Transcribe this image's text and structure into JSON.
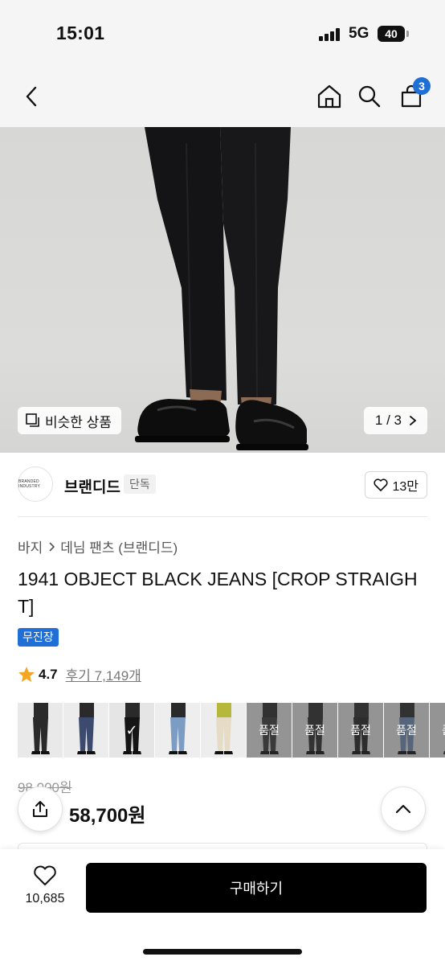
{
  "status_bar": {
    "time": "15:01",
    "network": "5G",
    "battery": "40"
  },
  "header": {
    "cart_count": "3"
  },
  "hero": {
    "similar_label": "비슷한 상품",
    "page_indicator": "1 / 3"
  },
  "brand": {
    "logo_text": "BRANDED INDUSTRY",
    "name": "브랜디드",
    "tag": "단독",
    "likes": "13만"
  },
  "breadcrumb": {
    "level1": "바지",
    "level2": "데님 팬츠 (브랜디드)"
  },
  "product": {
    "title": "1941 OBJECT BLACK JEANS [CROP STRAIGHT]",
    "badge": "무진장",
    "rating": "4.7",
    "review_label": "후기 7,149개"
  },
  "color_options": [
    {
      "jeans": "#2a2a2a",
      "bg": "#e9e9e9",
      "selected": false,
      "sold_out": false
    },
    {
      "jeans": "#3b4a6e",
      "bg": "#ececec",
      "selected": false,
      "sold_out": false
    },
    {
      "jeans": "#151515",
      "bg": "#e5e5e5",
      "selected": true,
      "sold_out": false
    },
    {
      "jeans": "#7d9cc4",
      "bg": "#eeeeee",
      "selected": false,
      "sold_out": false
    },
    {
      "jeans": "#e6dcc6",
      "bg": "#ededed",
      "selected": false,
      "sold_out": false,
      "top": "#b5b83a"
    },
    {
      "jeans": "#3a3a3a",
      "bg": "#dcdcdc",
      "selected": false,
      "sold_out": true
    },
    {
      "jeans": "#2b2b2b",
      "bg": "#dcdcdc",
      "selected": false,
      "sold_out": true
    },
    {
      "jeans": "#222222",
      "bg": "#dcdcdc",
      "selected": false,
      "sold_out": true
    },
    {
      "jeans": "#6e88ad",
      "bg": "#dcdcdc",
      "selected": false,
      "sold_out": true
    },
    {
      "jeans": "#3d3d3d",
      "bg": "#dcdcdc",
      "selected": false,
      "sold_out": true
    }
  ],
  "sold_out_label": "품절",
  "price": {
    "original": "98,000원",
    "sale": "58,700원"
  },
  "bottom_bar": {
    "wish_count": "10,685",
    "buy_label": "구매하기"
  },
  "colors": {
    "accent": "#1f6fd6",
    "star": "#f5a623",
    "buy_button": "#000000"
  }
}
